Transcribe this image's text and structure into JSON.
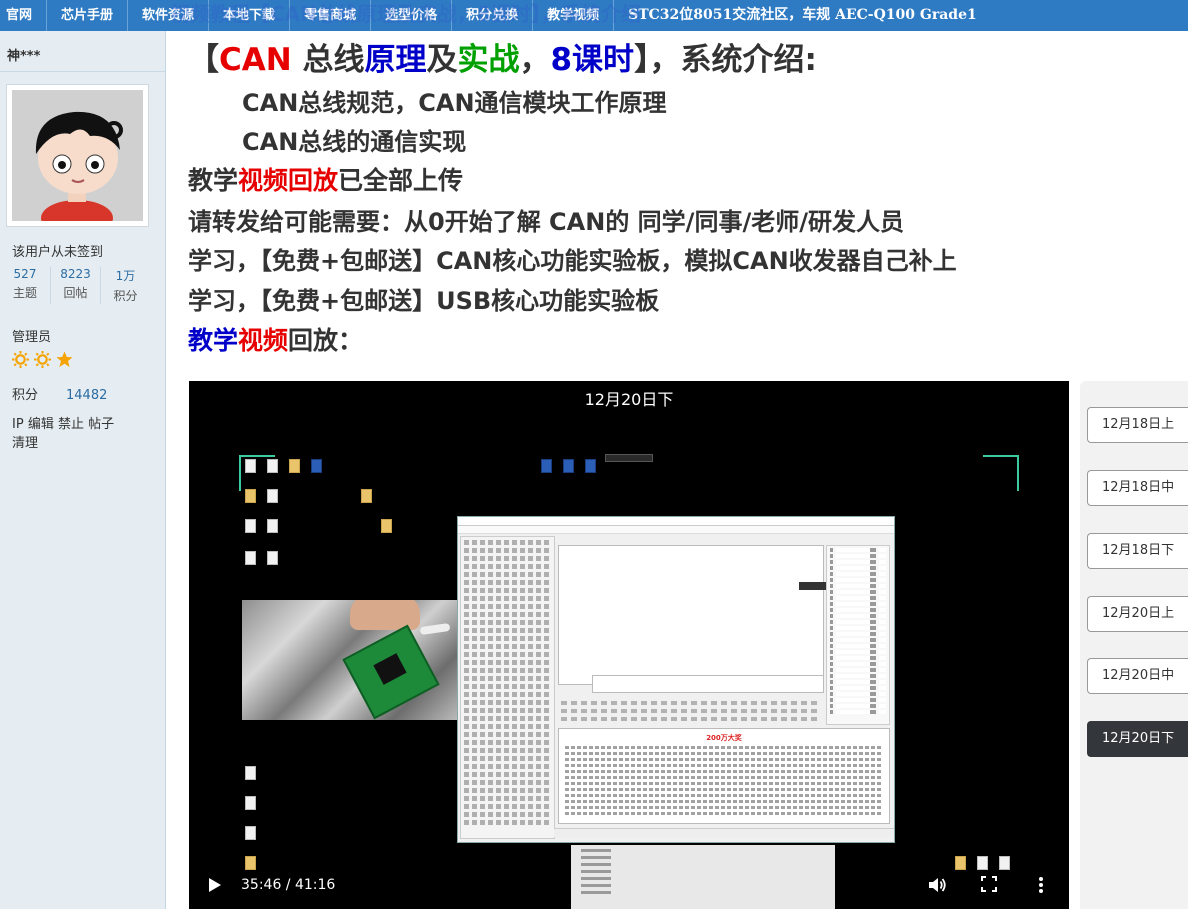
{
  "nav": {
    "items": [
      "官网",
      "芯片手册",
      "软件资源",
      "本地下载",
      "零售商城",
      "选型价格",
      "积分兑换",
      "教学视频",
      "STC32位8051交流社区，车规 AEC-Q100 Grade1"
    ]
  },
  "title_strip": "视频教程【CAN总线原理及实战，8课时】，系统介绍",
  "sidebar": {
    "username": "神***",
    "not_signed": "该用户从未签到",
    "stats": [
      {
        "value": "527",
        "label": "主题"
      },
      {
        "value": "8223",
        "label": "回帖"
      },
      {
        "value": "1万",
        "label": "积分"
      }
    ],
    "role": "管理员",
    "points_label": "积分",
    "points_value": "14482",
    "admin_links": [
      "IP",
      "编辑",
      "禁止",
      "帖子",
      "清理"
    ]
  },
  "post": {
    "l1": {
      "a": "【",
      "b": "CAN",
      "c": " 总线",
      "d": "原理",
      "e": "及",
      "f": "实战",
      "g": "，",
      "h": "8课时",
      "i": "】，系统介绍:"
    },
    "l2": "CAN总线规范，CAN通信模块工作原理",
    "l3": "CAN总线的通信实现",
    "l4": {
      "a": "教学",
      "b": "视频回放",
      "c": "已全部上传"
    },
    "l5": "请转发给可能需要：从0开始了解 CAN的 同学/同事/老师/研发人员",
    "l6": "学习，【免费+包邮送】CAN核心功能实验板，模拟CAN收发器自己补上",
    "l7": "学习，【免费+包邮送】USB核心功能实验板",
    "l8": {
      "a": "教学",
      "b": "视频",
      "c": "回放："
    }
  },
  "video": {
    "title": "12月20日下",
    "time": "35:46 / 41:16",
    "screen_heading": "200万大奖",
    "colors": {
      "accent_corner": "#3cc9a0"
    }
  },
  "playlist": {
    "items": [
      "12月18日上",
      "12月18日中",
      "12月18日下",
      "12月20日上",
      "12月20日中",
      "12月20日下"
    ],
    "active": "12月20日下"
  },
  "colors": {
    "nav_bg": "#2e7bc4",
    "sidebar_bg": "#e5edf2",
    "link": "#2b6ca3",
    "red": "#e60000",
    "blue": "#0000c8",
    "green": "#00a000",
    "star": "#f5a300"
  }
}
